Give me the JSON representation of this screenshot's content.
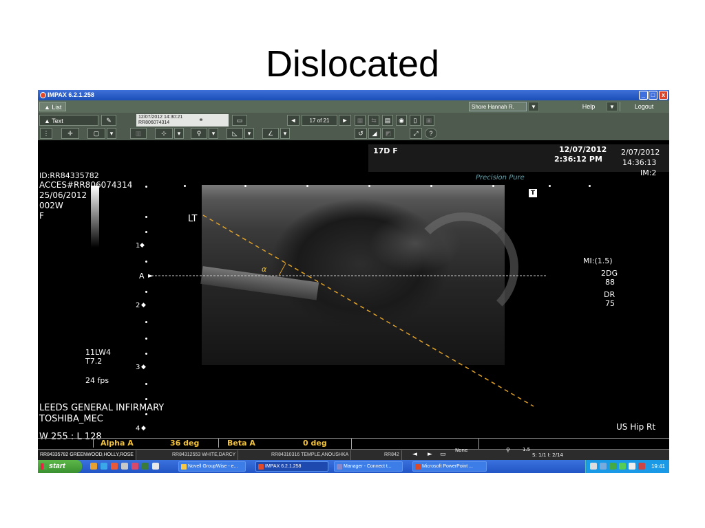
{
  "slide": {
    "title": "Dislocated"
  },
  "window": {
    "title": "IMPAX 6.2.1.258",
    "min": "_",
    "max": "□",
    "close": "x"
  },
  "menubar": {
    "list": "▲ List",
    "user": "Shore Hannah R.",
    "help": "Help",
    "logout": "Logout",
    "dropdown": "▼"
  },
  "toolbar": {
    "text_label": "▲   Text",
    "study_datetime": "12/07/2012 14:30:21",
    "study_accession": "RR806074314",
    "prev": "◄",
    "next": "►",
    "page": "17 of 21",
    "help_glyph": "?"
  },
  "overlay": {
    "age_sex": "17D  F",
    "header_date": "12/07/2012",
    "header_time": "2:36:12 PM",
    "right_date": "2/07/2012",
    "right_time": "14:36:13",
    "image_num": "IM:2",
    "patient_id": "ID:RR84335782",
    "accession": "ACCES#RR806074314",
    "dob": "25/06/2012",
    "age": "002W",
    "sex": "F",
    "brand": "Precision  Pure",
    "t_marker": "T",
    "side": "LT",
    "alpha_symbol": "α",
    "mi": "MI:(1.5)",
    "mode": "2DG",
    "gain": "88",
    "dr_label": "DR",
    "dr_value": "75",
    "scale_1": "1",
    "scale_a": "A",
    "scale_2": "2",
    "scale_3": "3",
    "scale_4": "4",
    "probe": "11LW4",
    "tfreq": "T7.2",
    "fps": "24 fps",
    "hospital": "LEEDS GENERAL INFIRMARY",
    "vendor": "TOSHIBA_MEC",
    "window_level": "W 255 : L 128",
    "region": "US Hip Rt"
  },
  "angles": {
    "alpha_label": "Alpha A",
    "alpha_value": "36  deg",
    "beta_label": "Beta A",
    "beta_value": "0  deg"
  },
  "patients": [
    "RR84335782  GREENWOOD,HOLLY,ROSE",
    "RR84312553  WHITE,DARCY",
    "RR84310316  TEMPLE,ANOUSHKA",
    "RR842"
  ],
  "status": {
    "none": "None",
    "zoom": "1.5",
    "series": "S: 1/1  I: 2/14"
  },
  "taskbar": {
    "start": "start",
    "items": [
      "Novell GroupWise - e...",
      "IMPAX 6.2.1.258",
      "Manager - Connect t...",
      "Microsoft PowerPoint ..."
    ],
    "clock": "19:41"
  },
  "colors": {
    "accent_yellow": "#f2c23a",
    "taskbar_blue": "#2255c5",
    "start_green": "#3a9030"
  }
}
